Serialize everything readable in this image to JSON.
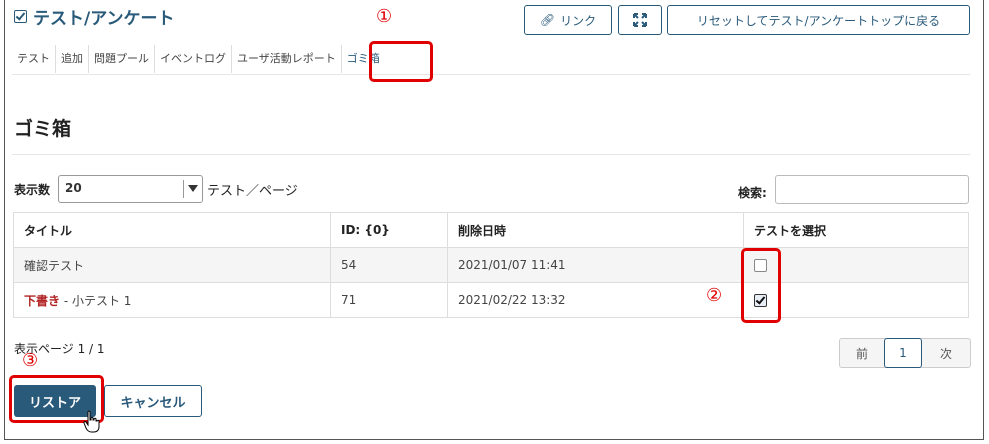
{
  "header": {
    "title": "テスト/アンケート",
    "link_label": "リンク",
    "reset_label": "リセットしてテスト/アンケートトップに戻る"
  },
  "tabs": [
    {
      "label": "テスト"
    },
    {
      "label": "追加"
    },
    {
      "label": "問題プール"
    },
    {
      "label": "イベントログ"
    },
    {
      "label": "ユーザ活動レポート"
    },
    {
      "label": "ゴミ箱"
    }
  ],
  "page": {
    "heading": "ゴミ箱"
  },
  "controls": {
    "per_page_label": "表示数",
    "per_page_value": "20",
    "per_page_suffix": "テスト／ページ",
    "search_label": "検索:"
  },
  "table": {
    "columns": [
      "タイトル",
      "ID: {0}",
      "削除日時",
      "テストを選択"
    ],
    "rows": [
      {
        "prefix": "",
        "title": "確認テスト",
        "id": "54",
        "date": "2021/01/07 11:41",
        "checked": false
      },
      {
        "prefix": "下書き",
        "title": " - 小テスト 1",
        "id": "71",
        "date": "2021/02/22 13:32",
        "checked": true
      }
    ]
  },
  "footer": {
    "page_info": "表示ページ 1 / 1",
    "prev": "前",
    "current": "1",
    "next": "次",
    "restore": "リストア",
    "cancel": "キャンセル"
  },
  "annotations": {
    "n1": "①",
    "n2": "②",
    "n3": "③"
  },
  "colors": {
    "accent": "#2a5a7a",
    "highlight": "#e00000",
    "draft": "#b22222"
  }
}
